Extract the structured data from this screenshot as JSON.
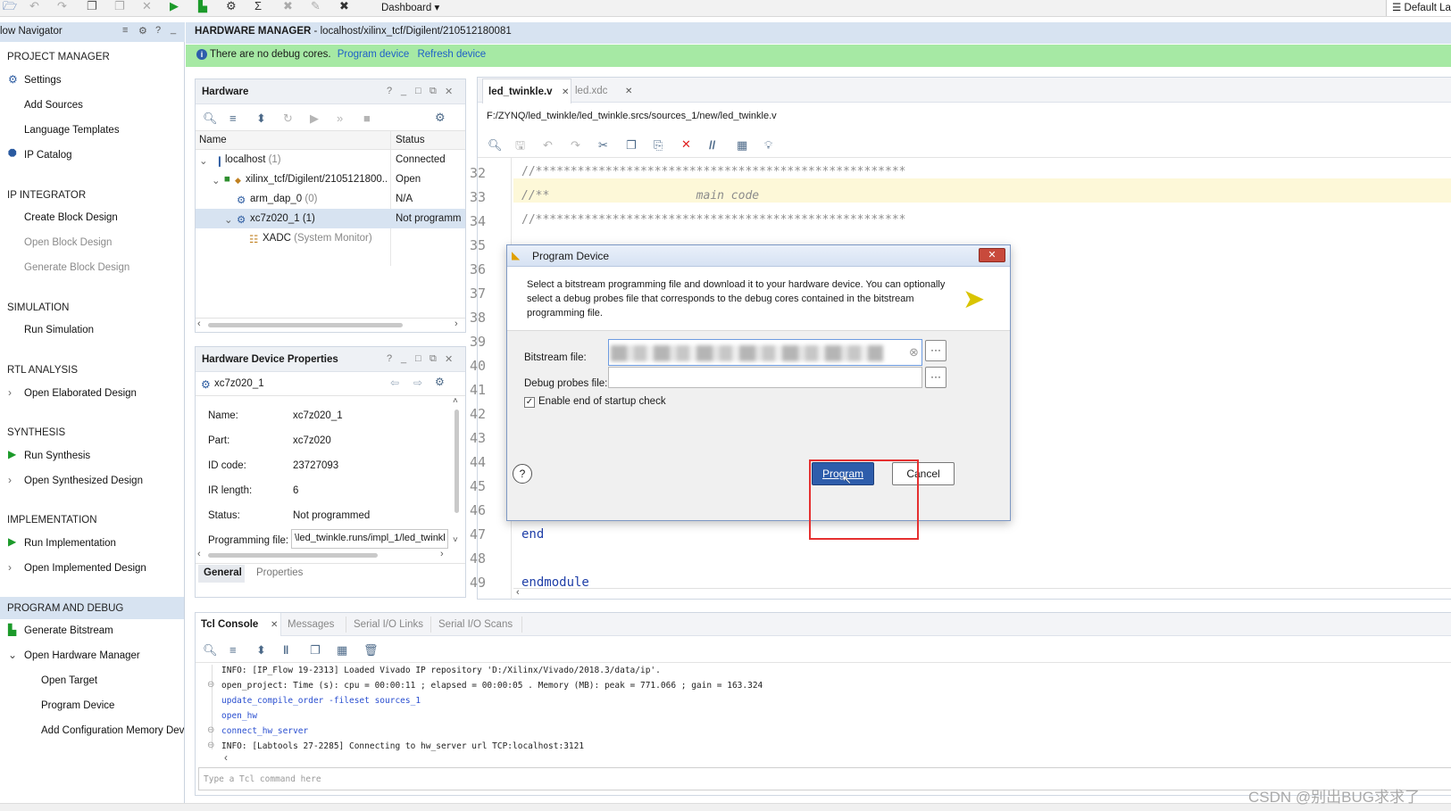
{
  "toolbar": {
    "dashboard": "Dashboard",
    "layout": "Default La"
  },
  "flow_navigator": {
    "title": "low Navigator",
    "sections": [
      {
        "label": "PROJECT MANAGER",
        "items": [
          {
            "label": "Settings",
            "icon": "gear-icon"
          },
          {
            "label": "Add Sources"
          },
          {
            "label": "Language Templates"
          },
          {
            "label": "IP Catalog",
            "icon": "ip-catalog-icon"
          }
        ]
      },
      {
        "label": "IP INTEGRATOR",
        "items": [
          {
            "label": "Create Block Design"
          },
          {
            "label": "Open Block Design"
          },
          {
            "label": "Generate Block Design"
          }
        ]
      },
      {
        "label": "SIMULATION",
        "items": [
          {
            "label": "Run Simulation"
          }
        ]
      },
      {
        "label": "RTL ANALYSIS",
        "items": [
          {
            "label": "Open Elaborated Design"
          }
        ]
      },
      {
        "label": "SYNTHESIS",
        "items": [
          {
            "label": "Run Synthesis"
          },
          {
            "label": "Open Synthesized Design"
          }
        ]
      },
      {
        "label": "IMPLEMENTATION",
        "items": [
          {
            "label": "Run Implementation"
          },
          {
            "label": "Open Implemented Design"
          }
        ]
      },
      {
        "label": "PROGRAM AND DEBUG",
        "items": [
          {
            "label": "Generate Bitstream"
          },
          {
            "label": "Open Hardware Manager"
          },
          {
            "label": "Open Target"
          },
          {
            "label": "Program Device"
          },
          {
            "label": "Add Configuration Memory Devic"
          }
        ]
      }
    ]
  },
  "hw_manager": {
    "title_bold": "HARDWARE MANAGER",
    "title_rest": " - localhost/xilinx_tcf/Digilent/210512180081",
    "info": "There are no debug cores.",
    "program_link": "Program device",
    "refresh_link": "Refresh device"
  },
  "hardware_panel": {
    "title": "Hardware",
    "col_name": "Name",
    "col_status": "Status",
    "rows": [
      {
        "name": "localhost",
        "count": " (1)",
        "status": "Connected"
      },
      {
        "name": "xilinx_tcf/Digilent/2105121800...",
        "count": "",
        "status": "Open"
      },
      {
        "name": "arm_dap_0",
        "count": " (0)",
        "status": "N/A"
      },
      {
        "name": "xc7z020_1 (1)",
        "count": "",
        "status": "Not programm"
      },
      {
        "name": "XADC",
        "count": " (System Monitor)",
        "status": ""
      }
    ]
  },
  "props_panel": {
    "title": "Hardware Device Properties",
    "device": "xc7z020_1",
    "rows": [
      {
        "k": "Name:",
        "v": "xc7z020_1"
      },
      {
        "k": "Part:",
        "v": "xc7z020"
      },
      {
        "k": "ID code:",
        "v": "23727093"
      },
      {
        "k": "IR length:",
        "v": "6"
      },
      {
        "k": "Status:",
        "v": "Not programmed"
      },
      {
        "k": "Programming file:",
        "v": "\\led_twinkle.runs/impl_1/led_twinkl"
      }
    ],
    "tabs": [
      "General",
      "Properties"
    ]
  },
  "editor": {
    "tabs": [
      "led_twinkle.v",
      "led.xdc"
    ],
    "path": "F:/ZYNQ/led_twinkle/led_twinkle.srcs/sources_1/new/led_twinkle.v",
    "lines": [
      {
        "n": "32",
        "text": "//*****************************************************"
      },
      {
        "n": "33",
        "text": "//**                     main code"
      },
      {
        "n": "34",
        "text": "//*****************************************************"
      },
      {
        "n": "35",
        "text": ""
      },
      {
        "n": "36",
        "text": ""
      },
      {
        "n": "37",
        "text": ""
      },
      {
        "n": "38",
        "text": ""
      },
      {
        "n": "39",
        "text": ""
      },
      {
        "n": "40",
        "text": ""
      },
      {
        "n": "41",
        "text": ""
      },
      {
        "n": "42",
        "text": ""
      },
      {
        "n": "43",
        "text": ""
      },
      {
        "n": "44",
        "text": ""
      },
      {
        "n": "45",
        "text": ""
      },
      {
        "n": "46",
        "text": ""
      },
      {
        "n": "47",
        "text": "end"
      },
      {
        "n": "48",
        "text": ""
      },
      {
        "n": "49",
        "text": "endmodule"
      }
    ]
  },
  "dialog": {
    "title": "Program Device",
    "desc": "Select a bitstream programming file and download it to your hardware device. You can optionally select a debug probes file that corresponds to the debug cores contained in the bitstream programming file.",
    "bitstream_label": "Bitstream file:",
    "debug_label": "Debug probes file:",
    "checkbox_label": "Enable end of startup check",
    "program_btn": "Program",
    "cancel_btn": "Cancel",
    "browse": "···",
    "help": "?"
  },
  "console": {
    "tabs": [
      "Tcl Console",
      "Messages",
      "Serial I/O Links",
      "Serial I/O Scans"
    ],
    "lines": [
      {
        "text": "INFO: [IP_Flow 19-2313] Loaded Vivado IP repository 'D:/Xilinx/Vivado/2018.3/data/ip'.",
        "blue": false
      },
      {
        "text": "open_project: Time (s): cpu = 00:00:11 ; elapsed = 00:00:05 . Memory (MB): peak = 771.066 ; gain = 163.324",
        "blue": false
      },
      {
        "text": "update_compile_order -fileset sources_1",
        "blue": true
      },
      {
        "text": "open_hw",
        "blue": true
      },
      {
        "text": "connect_hw_server",
        "blue": true
      },
      {
        "text": "INFO: [Labtools 27-2285] Connecting to hw_server url TCP:localhost:3121",
        "blue": false
      }
    ],
    "placeholder": "Type a Tcl command here"
  },
  "watermark": "CSDN @别出BUG求求了",
  "colors": {
    "accent": "#2e5dab",
    "green_bar": "#a6e9a4",
    "header_blue": "#d7e3f1",
    "highlight_red": "#e53030"
  }
}
